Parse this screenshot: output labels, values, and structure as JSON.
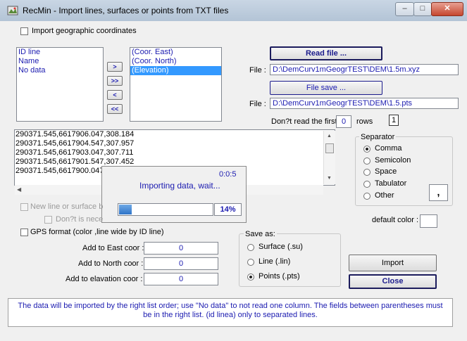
{
  "window": {
    "title": "RecMin - Import lines, surfaces or points from TXT files",
    "minimize": "–",
    "maximize": "□",
    "close": "✕"
  },
  "options": {
    "import_geo": "Import geographic coordinates",
    "new_line": "New line or surface b",
    "dont_necessary": "Don?t is nece",
    "gps_format": "GPS format (color ,line wide by ID line)"
  },
  "left_list": [
    "ID line",
    "Name",
    "No data"
  ],
  "right_list": [
    "(Coor. East)",
    "(Coor. North)",
    "(Elevation)"
  ],
  "move_buttons": [
    ">",
    ">>",
    "<",
    "<<"
  ],
  "read_file": {
    "button": "Read file ...",
    "label": "File :",
    "path": "D:\\DemCurv1mGeogrTEST\\DEM\\1.5m.xyz"
  },
  "save_file": {
    "button": "File save ...",
    "label": "File :",
    "path": "D:\\DemCurv1mGeogrTEST\\DEM\\1.5.pts"
  },
  "skip_rows": {
    "prefix": "Don?t read the first",
    "value": "0",
    "suffix": "rows",
    "counter": "1"
  },
  "data_lines": [
    "290371.545,6617906.047,308.184",
    "290371.545,6617904.547,307.957",
    "290371.545,6617903.047,307.711",
    "290371.545,6617901.547,307.452",
    "290371.545,6617900.047"
  ],
  "progress": {
    "time": "0:0:5",
    "message": "Importing data, wait...",
    "percent_label": "14%",
    "fraction": 0.14
  },
  "separator": {
    "title": "Separator",
    "options": [
      "Comma",
      "Semicolon",
      "Space",
      "Tabulator",
      "Other"
    ],
    "selected": "Comma",
    "other_value": ","
  },
  "default_color": {
    "label": "default color :"
  },
  "offsets": {
    "east_label": "Add to East coor :",
    "east_value": "0",
    "north_label": "Add to North coor :",
    "north_value": "0",
    "elev_label": "Add to elavation coor :",
    "elev_value": "0"
  },
  "save_as": {
    "title": "Save as:",
    "options": [
      "Surface (.su)",
      "Line (.lin)",
      "Points (.pts)"
    ],
    "selected": "Points (.pts)"
  },
  "actions": {
    "import": "Import",
    "close": "Close"
  },
  "info": "The data will be imported by the right list order; use \"No data\" to not read one column. The fields between parentheses must be in the right list. (id linea) only to separated lines."
}
